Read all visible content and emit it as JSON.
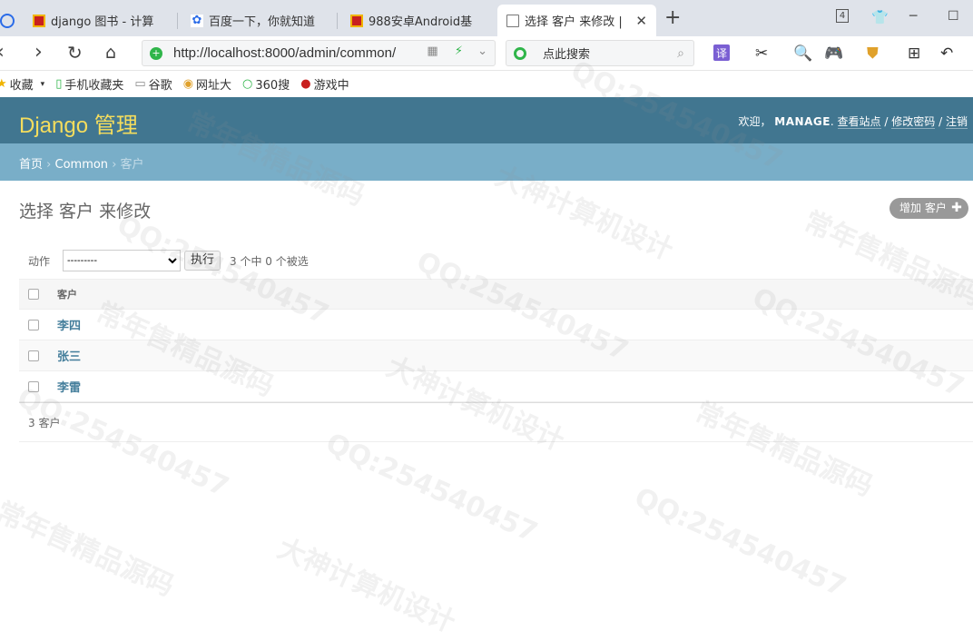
{
  "browser": {
    "tabs": [
      {
        "title": "django 图书 - 计算"
      },
      {
        "title": "百度一下，你就知道"
      },
      {
        "title": "988安卓Android基"
      },
      {
        "title": "选择 客户 来修改 |"
      }
    ],
    "tab_count_badge": "4",
    "url": "http://localhost:8000/admin/common/",
    "search_placeholder": "点此搜索",
    "translate_label": "译",
    "bookmarks": [
      {
        "label": "收藏",
        "icon": "star-icon"
      },
      {
        "label": "手机收藏夹",
        "icon": "phone-icon"
      },
      {
        "label": "谷歌",
        "icon": "page-icon"
      },
      {
        "label": "网址大",
        "icon": "globe-icon"
      },
      {
        "label": "360搜",
        "icon": "search-icon"
      },
      {
        "label": "游戏中",
        "icon": "game-icon"
      }
    ]
  },
  "admin": {
    "brand": "Django 管理",
    "user_tools": {
      "welcome": "欢迎，",
      "username": "MANAGE",
      "view_site": "查看站点",
      "change_password": "修改密码",
      "logout": "注销",
      "sep": "/"
    },
    "breadcrumbs": {
      "home": "首页",
      "app": "Common",
      "current": "客户",
      "sep": "›"
    },
    "title": "选择 客户 来修改",
    "add_button": "增加 客户",
    "actions": {
      "label": "动作",
      "selected_option": "---------",
      "go_button": "执行",
      "counter": "3 个中 0 个被选"
    },
    "table": {
      "column_header": "客户",
      "rows": [
        {
          "name": "李四"
        },
        {
          "name": "张三"
        },
        {
          "name": "李雷"
        }
      ]
    },
    "paginator": "3 客户"
  },
  "colors": {
    "header": "#417690",
    "breadcrumbs": "#79aec8",
    "brand_text": "#f5dd5d",
    "link": "#447e9b"
  }
}
